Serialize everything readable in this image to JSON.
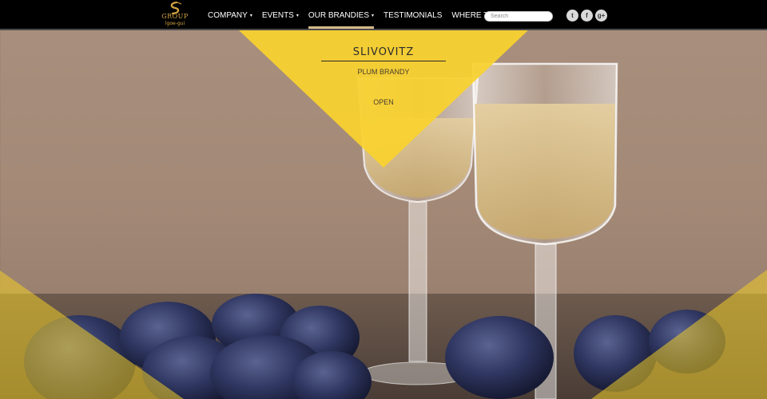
{
  "brand": {
    "logo_text": "GROUP",
    "logo_subtext": "lgoe-gui"
  },
  "nav": {
    "items": [
      {
        "label": "COMPANY",
        "has_caret": true
      },
      {
        "label": "EVENTS",
        "has_caret": true
      },
      {
        "label": "OUR BRANDIES",
        "has_caret": true,
        "active": true
      },
      {
        "label": "TESTIMONIALS",
        "has_caret": false
      },
      {
        "label": "WHERE TO BUY",
        "has_caret": false
      }
    ],
    "caret": "▾"
  },
  "search": {
    "placeholder": "Search",
    "value": ""
  },
  "social": {
    "twitter": "t",
    "facebook": "f",
    "googleplus": "g+"
  },
  "hero": {
    "title": "SLIVOVITZ",
    "subtitle": "PLUM BRANDY",
    "cta": "OPEN"
  },
  "colors": {
    "accent_yellow": "#f9d22e",
    "nav_active_underline": "#d5b98a",
    "logo_gold": "#d5a642"
  }
}
